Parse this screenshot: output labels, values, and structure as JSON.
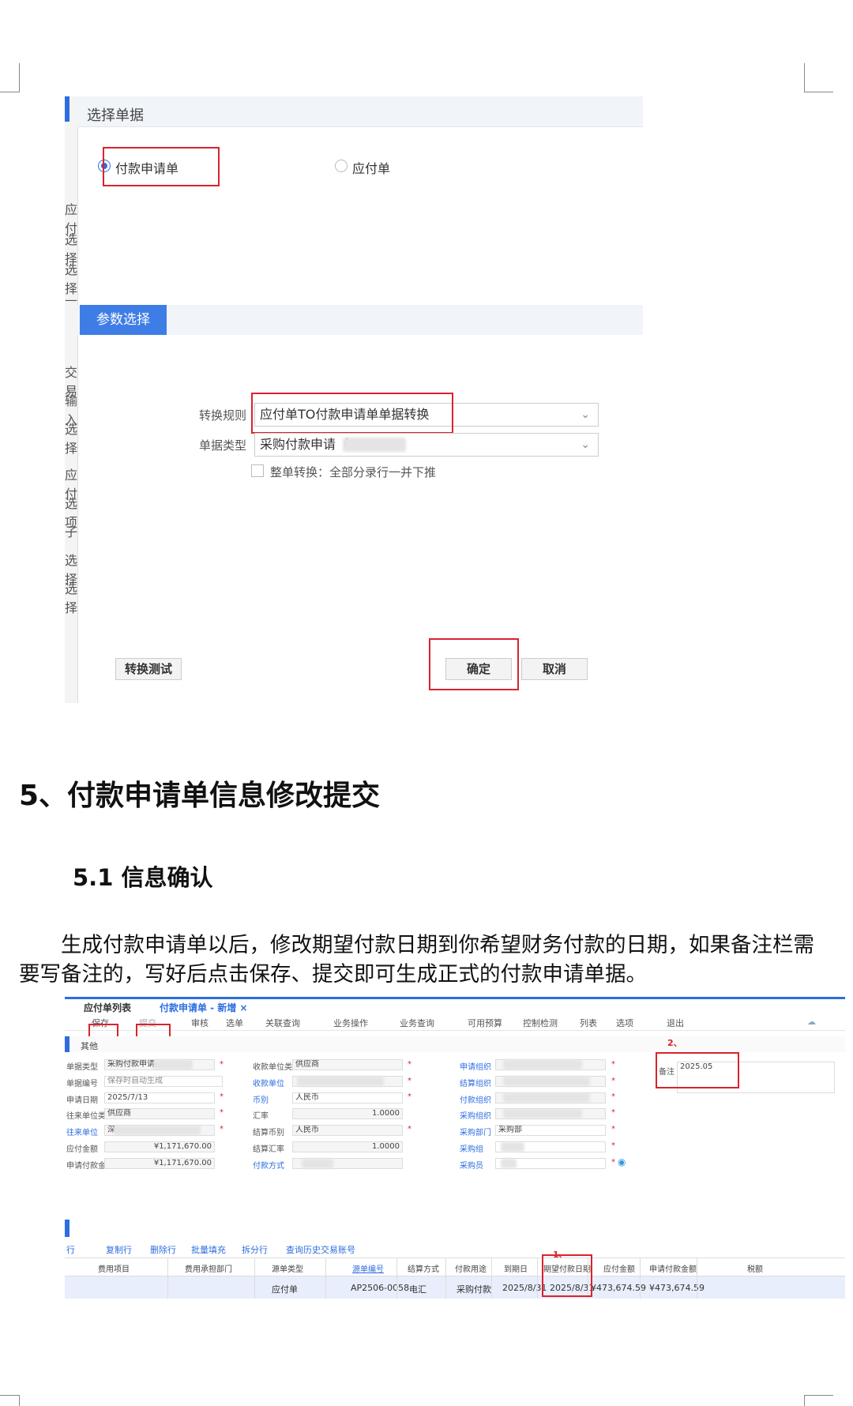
{
  "dialog": {
    "title": "选择单据",
    "radio_options": [
      {
        "label": "付款申请单",
        "selected": true
      },
      {
        "label": "应付单",
        "selected": false
      }
    ],
    "section_title": "参数选择",
    "fields": {
      "rule_label": "转换规则",
      "rule_value": "应付单TO付款申请单单据转换",
      "type_label": "单据类型",
      "type_value": "采购付款申请",
      "type_value_suffix": "（"
    },
    "whole_convert_label": "整单转换：全部分录行一并下推",
    "buttons": {
      "test": "转换测试",
      "ok": "确定",
      "cancel": "取消"
    },
    "left_fragments": [
      "应付",
      "选择",
      "选择",
      "—",
      "交易",
      "输入",
      "选择",
      "应付",
      "选项",
      "子",
      "选择",
      "选择"
    ]
  },
  "heading": "5、付款申请单信息修改提交",
  "subheading": "5.1 信息确认",
  "paragraph": "生成付款申请单以后，修改期望付款日期到你希望财务付款的日期，如果备注栏需要写备注的，写好后点击保存、提交即可生成正式的付款申请单据。",
  "form": {
    "tabs": [
      "应付单列表",
      "付款申请单 - 新增 ×"
    ],
    "toolbar": [
      "保存",
      "提交",
      "审核",
      "选单",
      "关联查询",
      "业务操作",
      "业务查询",
      "可用预算",
      "控制检测",
      "列表",
      "选项",
      "退出"
    ],
    "section": "其他",
    "fields_col1": [
      {
        "label": "单据类型",
        "value": "采购付款申请"
      },
      {
        "label": "单据编号",
        "value": "保存时自动生成"
      },
      {
        "label": "申请日期",
        "value": "2025/7/13"
      },
      {
        "label": "往来单位类型",
        "value": "供应商"
      },
      {
        "label": "往来单位",
        "value": "深"
      },
      {
        "label": "应付金额",
        "value": "¥1,171,670.00"
      },
      {
        "label": "申请付款金额",
        "value": "¥1,171,670.00"
      }
    ],
    "fields_col2": [
      {
        "label": "收款单位类型",
        "value": "供应商"
      },
      {
        "label": "收款单位",
        "value": ""
      },
      {
        "label": "币别",
        "value": "人民币"
      },
      {
        "label": "汇率",
        "value": "1.0000"
      },
      {
        "label": "结算币别",
        "value": "人民币"
      },
      {
        "label": "结算汇率",
        "value": "1.0000"
      },
      {
        "label": "付款方式",
        "value": ""
      }
    ],
    "fields_col3": [
      {
        "label": "申请组织",
        "value": ""
      },
      {
        "label": "结算组织",
        "value": ""
      },
      {
        "label": "付款组织",
        "value": ""
      },
      {
        "label": "采购组织",
        "value": ""
      },
      {
        "label": "采购部门",
        "value": "采购部"
      },
      {
        "label": "采购组",
        "value": ""
      },
      {
        "label": "采购员",
        "value": ""
      }
    ],
    "remark_label": "备注",
    "remark_value": "2025.05",
    "annotation_1": "1、",
    "annotation_2": "2、",
    "row_tools": [
      "行",
      "复制行",
      "删除行",
      "批量填充",
      "拆分行",
      "查询历史交易账号"
    ],
    "table_headers": [
      "费用项目",
      "费用承担部门",
      "源单类型",
      "源单编号",
      "结算方式",
      "付款用途",
      "到期日",
      "期望付款日期",
      "应付金额",
      "申请付款金额",
      "税额"
    ],
    "table_row": [
      "",
      "",
      "应付单",
      "AP2506-0058",
      "电汇",
      "采购付款",
      "2025/8/31",
      "2025/8/31",
      "¥473,674.59",
      "¥473,674.59",
      ""
    ]
  }
}
